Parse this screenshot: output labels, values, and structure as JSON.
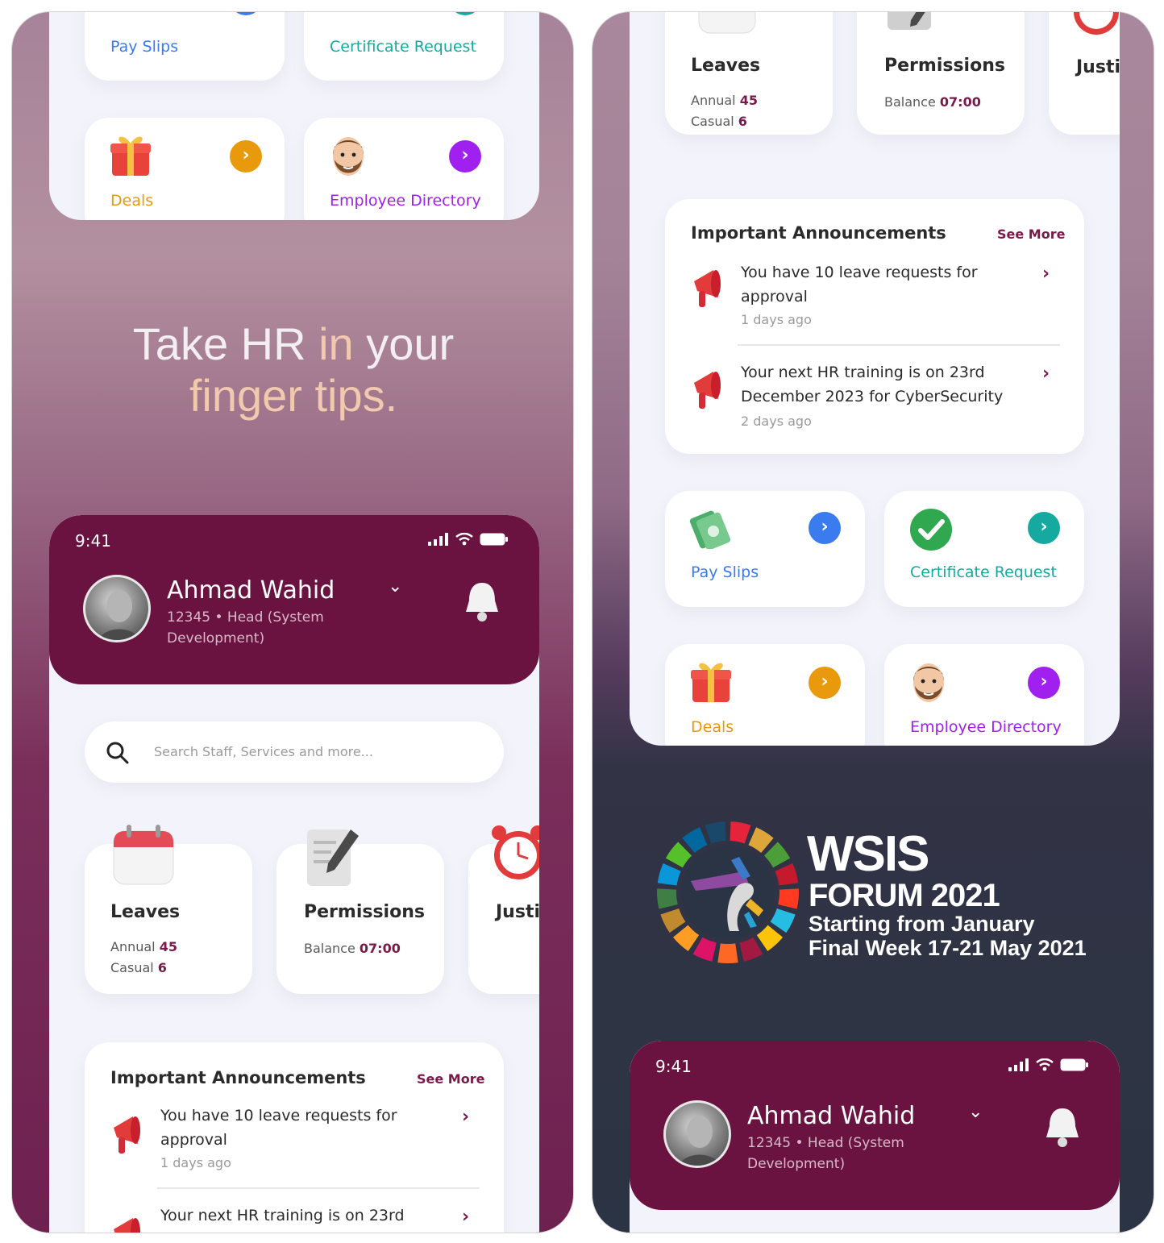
{
  "colors": {
    "brand": "#6a1340",
    "pay_slips": "#3a7bf0",
    "certificate": "#16a9a0",
    "deals": "#e89a0c",
    "directory": "#a020f0",
    "accent_text": "#f1c9ae"
  },
  "tiles": {
    "pay_slips": "Pay Slips",
    "certificate": "Certificate Request",
    "deals": "Deals",
    "directory": "Employee Directory",
    "arrow": "›"
  },
  "tagline": {
    "w1": "Take HR",
    "a1": "in",
    "w2": "your",
    "a2": "finger tips."
  },
  "status": {
    "time": "9:41"
  },
  "profile": {
    "name": "Ahmad Wahid",
    "line1": "12345 • Head (System",
    "line2": "Development)",
    "chevron": "⌄"
  },
  "search": {
    "placeholder": "Search Staff, Services and more..."
  },
  "quick": {
    "leaves_title": "Leaves",
    "annual_label": "Annual",
    "annual_value": "45",
    "casual_label": "Casual",
    "casual_value": "6",
    "permissions_title": "Permissions",
    "balance_label": "Balance",
    "balance_value": "07:00",
    "third_title": "Justi"
  },
  "announcements": {
    "title": "Important Announcements",
    "see_more": "See More",
    "items": [
      {
        "line1": "You have 10 leave requests for",
        "line2": "approval",
        "time": "1 days ago"
      },
      {
        "line1": "Your next HR training is on 23rd",
        "line2": "December 2023 for CyberSecurity",
        "time": "2 days ago"
      }
    ],
    "chevron": "›"
  },
  "wsis": {
    "title1": "WSIS",
    "title2": "FORUM 2021",
    "line1": "Starting from January",
    "line2": "Final Week 17-21 May 2021"
  }
}
